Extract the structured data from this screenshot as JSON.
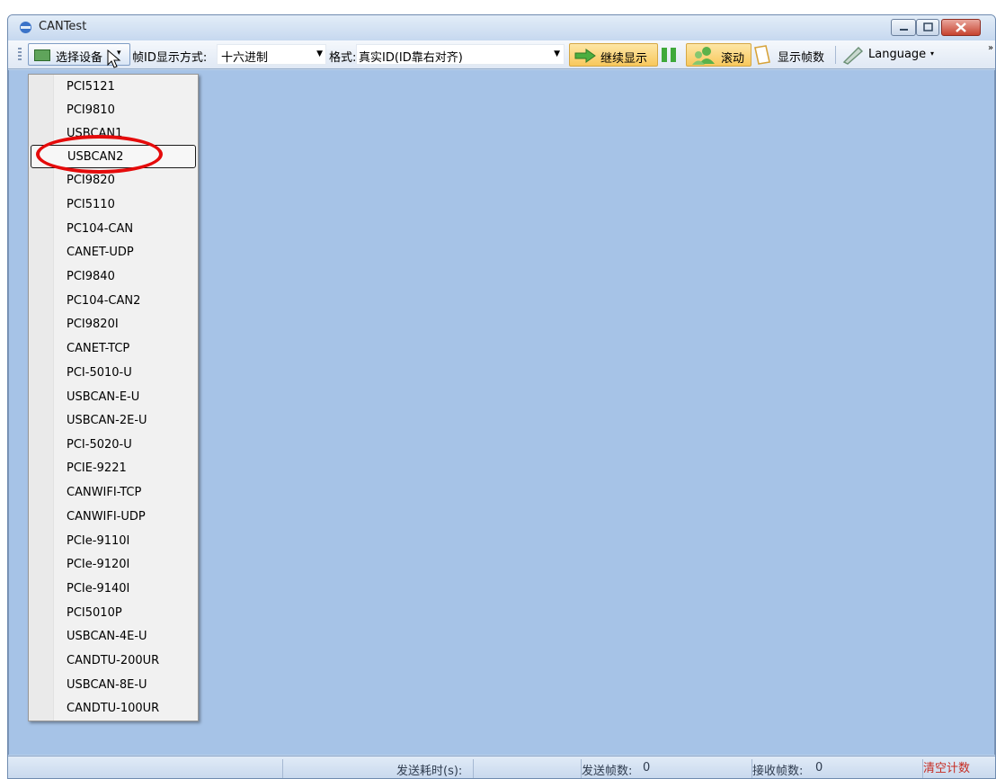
{
  "window": {
    "title": "CANTest"
  },
  "toolbar": {
    "select_device_label": "选择设备",
    "select_device_arrow": "▾",
    "id_format_label": "帧ID显示方式:",
    "id_format_value": "十六进制",
    "format_label": "格式:",
    "format_value": "真实ID(ID靠右对齐)",
    "dropdown_arrow": "▼",
    "continue_label": "继续显示",
    "scroll_label": "滚动",
    "show_frames_label": "显示帧数",
    "language_label": "Language",
    "language_arrow": "▾",
    "overflow": "»"
  },
  "device_menu": {
    "items": [
      "PCI5121",
      "PCI9810",
      "USBCAN1",
      "USBCAN2",
      "PCI9820",
      "PCI5110",
      "PC104-CAN",
      "CANET-UDP",
      "PCI9840",
      "PC104-CAN2",
      "PCI9820I",
      "CANET-TCP",
      "PCI-5010-U",
      "USBCAN-E-U",
      "USBCAN-2E-U",
      "PCI-5020-U",
      "PCIE-9221",
      "CANWIFI-TCP",
      "CANWIFI-UDP",
      "PCIe-9110I",
      "PCIe-9120I",
      "PCIe-9140I",
      "PCI5010P",
      "USBCAN-4E-U",
      "CANDTU-200UR",
      "USBCAN-8E-U",
      "CANDTU-100UR"
    ],
    "highlighted_item": "USBCAN2"
  },
  "statusbar": {
    "send_time_label": "发送耗时(s):",
    "send_frames_label": "发送帧数:",
    "send_frames_value": "0",
    "recv_frames_label": "接收帧数:",
    "recv_frames_value": "0",
    "clear_count_label": "清空计数"
  },
  "colors": {
    "main_background": "#a6c3e7",
    "annotation_circle": "#e50b0b",
    "active_button": "#f8c85c"
  }
}
